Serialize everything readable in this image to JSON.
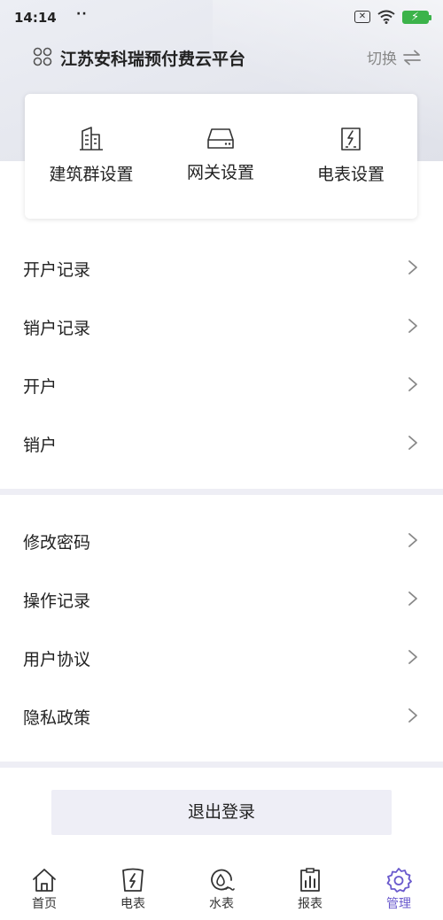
{
  "status_bar": {
    "time": "14:14",
    "dots": "··"
  },
  "header": {
    "title": "江苏安科瑞预付费云平台",
    "switch_label": "切换"
  },
  "quick_actions": [
    {
      "label": "建筑群设置",
      "icon": "building-icon"
    },
    {
      "label": "网关设置",
      "icon": "gateway-icon"
    },
    {
      "label": "电表设置",
      "icon": "meter-icon"
    }
  ],
  "account_menu": [
    {
      "label": "开户记录"
    },
    {
      "label": "销户记录"
    },
    {
      "label": "开户"
    },
    {
      "label": "销户"
    }
  ],
  "settings_menu": [
    {
      "label": "修改密码"
    },
    {
      "label": "操作记录"
    },
    {
      "label": "用户协议"
    },
    {
      "label": "隐私政策"
    }
  ],
  "logout_label": "退出登录",
  "bottom_nav": [
    {
      "label": "首页",
      "icon": "home-icon"
    },
    {
      "label": "电表",
      "icon": "electric-meter-icon"
    },
    {
      "label": "水表",
      "icon": "water-meter-icon"
    },
    {
      "label": "报表",
      "icon": "report-icon"
    },
    {
      "label": "管理",
      "icon": "gear-icon",
      "active": true
    }
  ],
  "colors": {
    "accent": "#6a5acd",
    "separator": "#eeeef5",
    "button_bg": "#eeeef6",
    "battery": "#3cb34a"
  }
}
